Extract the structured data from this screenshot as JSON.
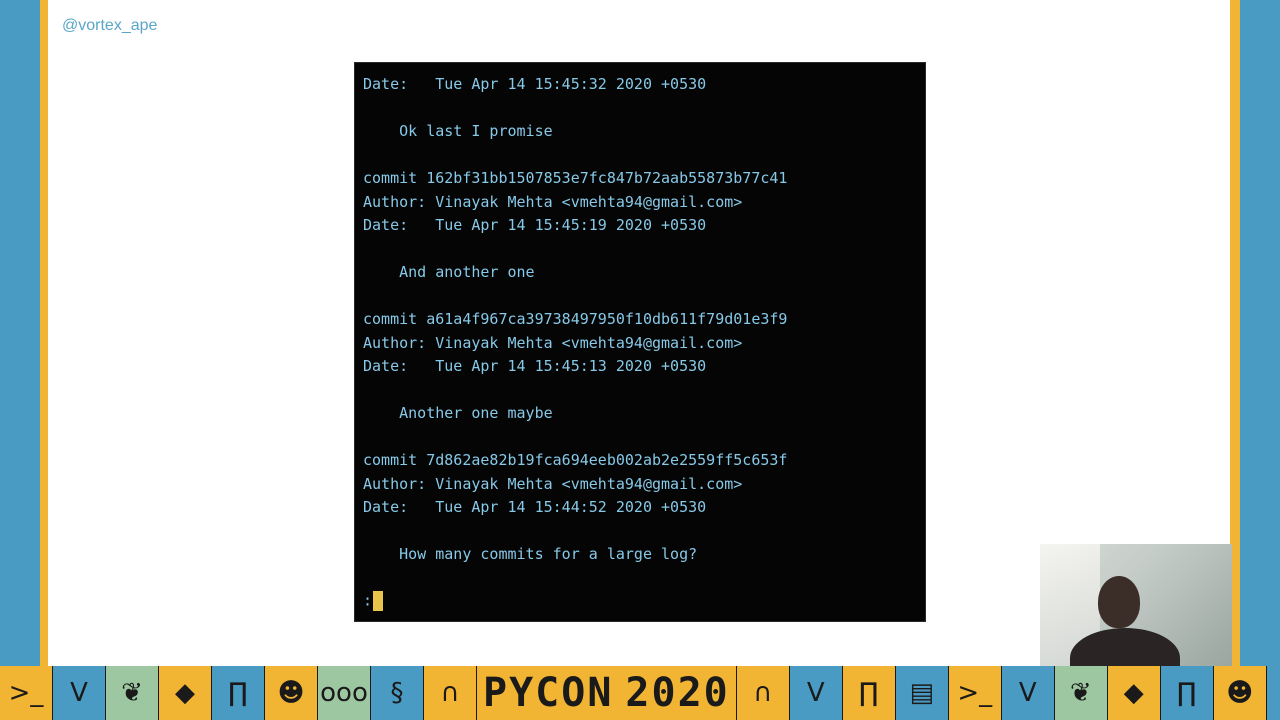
{
  "slide": {
    "handle": "@vortex_ape"
  },
  "terminal": {
    "lines": [
      "Date:   Tue Apr 14 15:45:32 2020 +0530",
      "",
      "    Ok last I promise",
      "",
      "commit 162bf31bb1507853e7fc847b72aab55873b77c41",
      "Author: Vinayak Mehta <vmehta94@gmail.com>",
      "Date:   Tue Apr 14 15:45:19 2020 +0530",
      "",
      "    And another one",
      "",
      "commit a61a4f967ca39738497950f10db611f79d01e3f9",
      "Author: Vinayak Mehta <vmehta94@gmail.com>",
      "Date:   Tue Apr 14 15:45:13 2020 +0530",
      "",
      "    Another one maybe",
      "",
      "commit 7d862ae82b19fca694eeb002ab2e2559ff5c653f",
      "Author: Vinayak Mehta <vmehta94@gmail.com>",
      "Date:   Tue Apr 14 15:44:52 2020 +0530",
      "",
      "    How many commits for a large log?"
    ],
    "prompt": ":"
  },
  "banner": {
    "logo_left": "PYCON",
    "logo_right": "2020",
    "tiles_left": [
      {
        "icon": "terminal-icon",
        "glyph": ">_",
        "color": "y"
      },
      {
        "icon": "chevron-icon",
        "glyph": "V",
        "color": "b"
      },
      {
        "icon": "leaf-icon",
        "glyph": "❦",
        "color": "g"
      },
      {
        "icon": "diamond-icon",
        "glyph": "◆",
        "color": "y"
      },
      {
        "icon": "pillars-icon",
        "glyph": "∏",
        "color": "b"
      },
      {
        "icon": "robot-icon",
        "glyph": "☻",
        "color": "y"
      },
      {
        "icon": "circuit-icon",
        "glyph": "ooo",
        "color": "g"
      },
      {
        "icon": "snake-icon",
        "glyph": "§",
        "color": "b"
      },
      {
        "icon": "arch-icon",
        "glyph": "∩",
        "color": "y"
      }
    ],
    "tiles_right": [
      {
        "icon": "arch-icon",
        "glyph": "∩",
        "color": "y"
      },
      {
        "icon": "chevron-icon",
        "glyph": "V",
        "color": "b"
      },
      {
        "icon": "pillars-icon",
        "glyph": "∏",
        "color": "y"
      },
      {
        "icon": "window-icon",
        "glyph": "▤",
        "color": "b"
      },
      {
        "icon": "terminal-icon",
        "glyph": ">_",
        "color": "y"
      },
      {
        "icon": "chevron-icon",
        "glyph": "V",
        "color": "b"
      },
      {
        "icon": "leaf-icon",
        "glyph": "❦",
        "color": "g"
      },
      {
        "icon": "diamond-icon",
        "glyph": "◆",
        "color": "y"
      },
      {
        "icon": "pillars-icon",
        "glyph": "∏",
        "color": "b"
      },
      {
        "icon": "robot-icon",
        "glyph": "☻",
        "color": "y"
      }
    ]
  },
  "colors": {
    "accent_yellow": "#f2b533",
    "accent_blue": "#4a9bc4",
    "terminal_text": "#87c9e8",
    "terminal_bg": "#050505",
    "cursor": "#e8c44a"
  }
}
